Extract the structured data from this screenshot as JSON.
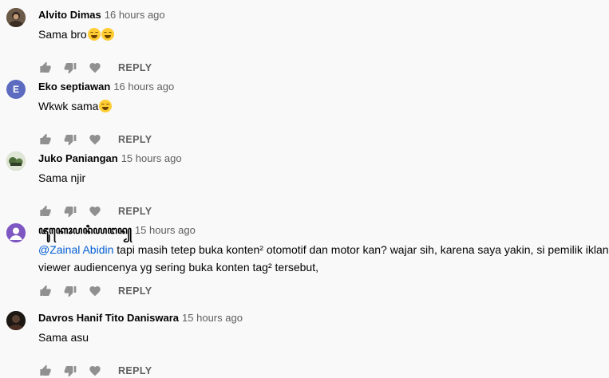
{
  "comments": [
    {
      "author": "Alvito Dimas",
      "time": "16 hours ago",
      "text": "Sama bro",
      "emoji_count": 2,
      "avatar": {
        "type": "photo",
        "color": "#5a4a3a"
      },
      "reply_label": "REPLY"
    },
    {
      "author": "Eko septiawan",
      "time": "16 hours ago",
      "text": "Wkwk sama",
      "emoji_count": 1,
      "avatar": {
        "type": "letter",
        "letter": "E",
        "color": "#5c6bc0"
      },
      "reply_label": "REPLY"
    },
    {
      "author": "Juko Paniangan",
      "time": "15 hours ago",
      "text": "Sama njir",
      "emoji_count": 0,
      "avatar": {
        "type": "photo",
        "color": "#6b7f5a"
      },
      "reply_label": "REPLY"
    },
    {
      "author": "ꦗꦸꦏꦺꦴꦥꦤꦶꦪꦔꦤ꧀",
      "time": "15 hours ago",
      "mention": "@Zainal Abidin",
      "text": " tapi masih tetep buka konten² otomotif dan motor kan? wajar sih, karena saya yakin, si pemilik iklan,",
      "text_line2": "viewer audiencenya yg sering buka konten tag² tersebut,",
      "emoji_count": 0,
      "avatar": {
        "type": "default",
        "color": "#7e57c2"
      },
      "reply_label": "REPLY"
    },
    {
      "author": "Davros Hanif Tito Daniswara",
      "time": "15 hours ago",
      "text": "Sama asu",
      "emoji_count": 0,
      "avatar": {
        "type": "photo",
        "color": "#3a2a20"
      },
      "reply_label": "REPLY"
    }
  ],
  "icons": {
    "like": "thumb-up-icon",
    "dislike": "thumb-down-icon",
    "heart": "heart-icon"
  },
  "colors": {
    "background": "#f9f9f9",
    "mention": "#065fd4",
    "meta": "#606060",
    "icon": "#909090"
  }
}
